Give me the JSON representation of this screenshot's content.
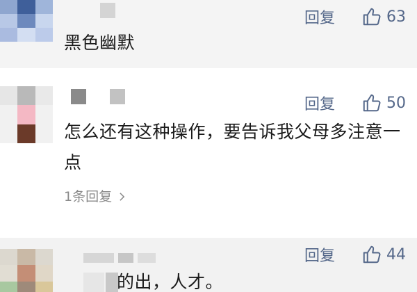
{
  "comments": [
    {
      "text": "黑色幽默",
      "reply_label": "回复",
      "likes": "63",
      "avatar_colors": [
        "#8fa6cf",
        "#3f5f9a",
        "#9fb5da",
        "#b8c8e6",
        "#6d89bd",
        "#c8d6ee",
        "#aabbe0",
        "#d3def2",
        "#bccbea"
      ]
    },
    {
      "text": "怎么还有这种操作，要告诉我父母多注意一点",
      "reply_label": "回复",
      "likes": "50",
      "replies": "1条回复",
      "avatar_colors": [
        "#e6e6e6",
        "#b9b9b9",
        "#e9e9e9",
        "#f1f1f1",
        "#f4b8c4",
        "#f1f1f1",
        "#f1f1f1",
        "#6b3a29",
        "#f1f1f1"
      ]
    },
    {
      "text": "的出，人才。",
      "reply_label": "回复",
      "likes": "44",
      "avatar_colors": [
        "#dcd8cf",
        "#c9b9a6",
        "#dcd8cf",
        "#e1ddd3",
        "#c48e76",
        "#e0d7c7",
        "#a8c8a0",
        "#9e8a7a",
        "#d9c79a"
      ]
    }
  ],
  "colors": {
    "accent": "#55688a",
    "text": "#1a1a1a",
    "muted": "#8a8a8a"
  },
  "icons": {
    "like": "thumbs-up-icon",
    "chevron": "chevron-right-icon"
  }
}
